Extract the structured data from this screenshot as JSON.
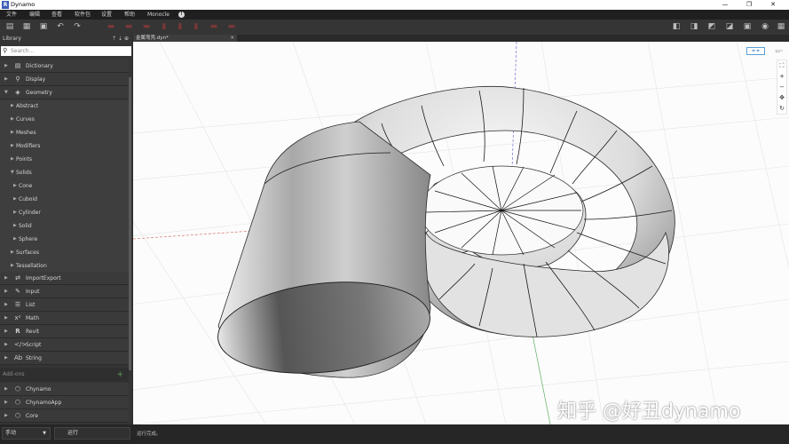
{
  "window": {
    "app_icon": "R",
    "title": "Dynamo",
    "minimize": "—",
    "maximize": "❐",
    "close": "✕"
  },
  "menu": [
    "文件",
    "编辑",
    "查看",
    "软件包",
    "设置",
    "帮助",
    "Monocle"
  ],
  "menu_info_icon": "!",
  "library": {
    "header": "Library",
    "header_icons": "⇡ ⇣ ⊕",
    "search_placeholder": "Search...",
    "categories": [
      {
        "label": "Dictionary",
        "icon": "dictionary-icon"
      },
      {
        "label": "Display",
        "icon": "display-icon"
      },
      {
        "label": "Geometry",
        "icon": "geometry-icon"
      }
    ],
    "geometry_children": [
      "Abstract",
      "Curves",
      "Meshes",
      "Modifiers",
      "Points",
      "Solids"
    ],
    "solids_children": [
      "Cone",
      "Cuboid",
      "Cylinder",
      "Solid",
      "Sphere"
    ],
    "geometry_children_after": [
      "Surfaces",
      "Tessellation"
    ],
    "categories_after": [
      {
        "label": "ImportExport",
        "icon": "import-export-icon"
      },
      {
        "label": "Input",
        "icon": "input-icon"
      },
      {
        "label": "List",
        "icon": "list-icon"
      },
      {
        "label": "Math",
        "icon": "math-icon"
      },
      {
        "label": "Revit",
        "icon": "revit-icon"
      },
      {
        "label": "Script",
        "icon": "script-icon"
      },
      {
        "label": "String",
        "icon": "string-icon"
      }
    ],
    "addons_label": "Add-ons",
    "addons": [
      {
        "label": "Chynamo",
        "icon": "package-icon"
      },
      {
        "label": "ChynamoApp",
        "icon": "package-icon"
      },
      {
        "label": "Core",
        "icon": "package-icon"
      }
    ]
  },
  "tab": {
    "label": "金属弯壳.dyn*",
    "close": "✕"
  },
  "canvas": {
    "view_toggle": "⚭⚭",
    "view_toggle2": "▭◦",
    "nav_buttons": [
      "⛶",
      "+",
      "−",
      "✥",
      "↻"
    ]
  },
  "watermark": "知乎 @好丑dynamo",
  "status": {
    "run_mode": "手动",
    "run_button": "运行",
    "run_status": "运行完成。"
  },
  "colors": {
    "accent": "#3b5db6",
    "panel": "#353535",
    "canvas_bg": "#fcfcfc"
  }
}
